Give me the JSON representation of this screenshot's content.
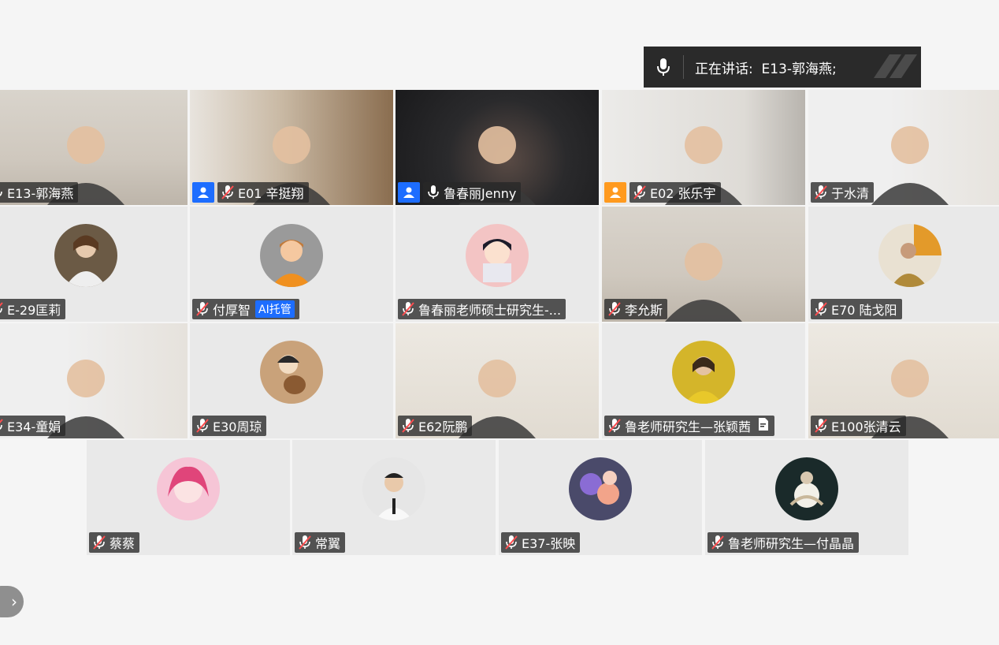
{
  "speaking_banner": {
    "prefix": "正在讲话:",
    "speaker": "E13-郭海燕;"
  },
  "pager": {
    "icon": "chevron-right-icon",
    "glyph": "›"
  },
  "colors": {
    "active_border": "#36c28a",
    "host_blue": "#1d6dff",
    "cohost_orange": "#ff9a1f",
    "mic_muted_red": "#ff4d4f"
  },
  "participants": [
    {
      "name": "E13-郭海燕",
      "kind": "video",
      "mic": "on",
      "active": true,
      "badge": "",
      "scene": "shelf"
    },
    {
      "name": "E01 辛挺翔",
      "kind": "video",
      "mic": "muted",
      "badge": "host",
      "scene": "room"
    },
    {
      "name": "鲁春丽Jenny",
      "kind": "video",
      "mic": "on",
      "badge": "host",
      "scene": "dark"
    },
    {
      "name": "E02 张乐宇",
      "kind": "video",
      "mic": "muted",
      "badge": "cohost",
      "scene": "bright"
    },
    {
      "name": "于水清",
      "kind": "video",
      "mic": "muted",
      "badge": "",
      "scene": "white"
    },
    {
      "name": "E-29匡莉",
      "kind": "avatar",
      "mic": "muted",
      "badge": "",
      "avatar": "painting"
    },
    {
      "name": "付厚智",
      "tag": "AI托管",
      "kind": "avatar",
      "mic": "muted",
      "badge": "",
      "avatar": "default"
    },
    {
      "name": "鲁春丽老师硕士研究生-...",
      "kind": "avatar",
      "mic": "muted",
      "badge": "",
      "avatar": "cartoon"
    },
    {
      "name": "李允斯",
      "kind": "video",
      "mic": "muted",
      "badge": "",
      "scene": "shelf"
    },
    {
      "name": "E70 陆戈阳",
      "kind": "avatar",
      "mic": "muted",
      "badge": "",
      "avatar": "photo-warm"
    },
    {
      "name": "E34-童娟",
      "kind": "video",
      "mic": "muted",
      "badge": "",
      "scene": "white"
    },
    {
      "name": "E30周琼",
      "kind": "avatar",
      "mic": "muted",
      "badge": "",
      "avatar": "lute-girl"
    },
    {
      "name": "E62阮鹏",
      "kind": "video",
      "mic": "muted",
      "badge": "",
      "scene": "lamp"
    },
    {
      "name": "鲁老师研究生—张颖茜",
      "kind": "avatar",
      "mic": "muted",
      "badge": "",
      "avatar": "photo-yellow",
      "doc_icon": true
    },
    {
      "name": "E100张清云",
      "kind": "video",
      "mic": "muted",
      "badge": "",
      "scene": "lamp"
    },
    {
      "name": "蔡蔡",
      "kind": "avatar",
      "mic": "muted",
      "badge": "",
      "avatar": "anime-pink"
    },
    {
      "name": "常翼",
      "kind": "avatar",
      "mic": "muted",
      "badge": "",
      "avatar": "suit"
    },
    {
      "name": "E37-张映",
      "kind": "avatar",
      "mic": "muted",
      "badge": "",
      "avatar": "flowers"
    },
    {
      "name": "鲁老师研究生—付晶晶",
      "kind": "avatar",
      "mic": "muted",
      "badge": "",
      "avatar": "moon"
    }
  ]
}
